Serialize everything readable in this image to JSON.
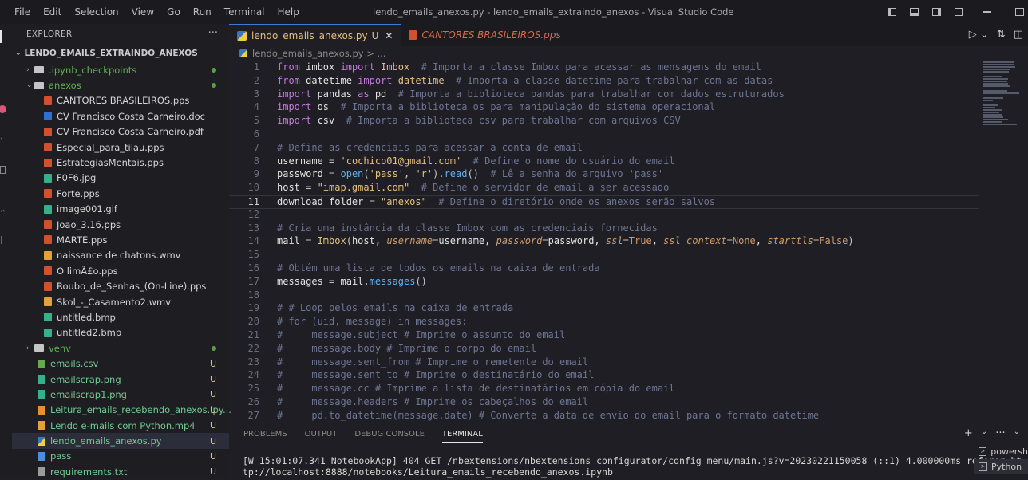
{
  "menubar": [
    "File",
    "Edit",
    "Selection",
    "View",
    "Go",
    "Run",
    "Terminal",
    "Help"
  ],
  "window_title": "lendo_emails_anexos.py - lendo_emails_extraindo_anexos - Visual Studio Code",
  "sidebar": {
    "title": "EXPLORER",
    "more": "···",
    "root": "LENDO_EMAILS_EXTRAINDO_ANEXOS",
    "items": [
      {
        "label": ".ipynb_checkpoints",
        "type": "folder",
        "indent": 1,
        "chevron": "›",
        "status": "dot",
        "color": "#61b04f"
      },
      {
        "label": "anexos",
        "type": "folder-open",
        "indent": 1,
        "chevron": "⌄",
        "status": "dot",
        "color": "#61b04f"
      },
      {
        "label": "CANTORES BRASILEIROS.pps",
        "type": "pps",
        "indent": 2,
        "color": "#d6d6d6"
      },
      {
        "label": "CV Francisco Costa Carneiro.doc",
        "type": "doc",
        "indent": 2,
        "color": "#d6d6d6"
      },
      {
        "label": "CV Francisco Costa Carneiro.pdf",
        "type": "pdf",
        "indent": 2,
        "color": "#d6d6d6"
      },
      {
        "label": "Especial_para_tilau.pps",
        "type": "pps",
        "indent": 2,
        "color": "#d6d6d6"
      },
      {
        "label": "EstrategiasMentais.pps",
        "type": "pps",
        "indent": 2,
        "color": "#d6d6d6"
      },
      {
        "label": "F0F6.jpg",
        "type": "img",
        "indent": 2,
        "color": "#d6d6d6"
      },
      {
        "label": "Forte.pps",
        "type": "pps",
        "indent": 2,
        "color": "#d6d6d6"
      },
      {
        "label": "image001.gif",
        "type": "img",
        "indent": 2,
        "color": "#d6d6d6"
      },
      {
        "label": "Joao_3.16.pps",
        "type": "pps",
        "indent": 2,
        "color": "#d6d6d6"
      },
      {
        "label": "MARTE.pps",
        "type": "pps",
        "indent": 2,
        "color": "#d6d6d6"
      },
      {
        "label": "naissance de chatons.wmv",
        "type": "video",
        "indent": 2,
        "color": "#d6d6d6"
      },
      {
        "label": "O limÃ£o.pps",
        "type": "pps",
        "indent": 2,
        "color": "#d6d6d6"
      },
      {
        "label": "Roubo_de_Senhas_(On-Line).pps",
        "type": "pps",
        "indent": 2,
        "color": "#d6d6d6"
      },
      {
        "label": "Skol_-_Casamento2.wmv",
        "type": "video",
        "indent": 2,
        "color": "#d6d6d6"
      },
      {
        "label": "untitled.bmp",
        "type": "img",
        "indent": 2,
        "color": "#d6d6d6"
      },
      {
        "label": "untitled2.bmp",
        "type": "img",
        "indent": 2,
        "color": "#d6d6d6"
      },
      {
        "label": "venv",
        "type": "folder",
        "indent": 1,
        "chevron": "›",
        "status": "dot",
        "color": "#61b04f"
      },
      {
        "label": "emails.csv",
        "type": "csv",
        "indent": 1,
        "status": "U",
        "color": "#73c991"
      },
      {
        "label": "emailscrap.png",
        "type": "img",
        "indent": 1,
        "status": "U",
        "color": "#73c991"
      },
      {
        "label": "emailscrap1.png",
        "type": "img",
        "indent": 1,
        "status": "U",
        "color": "#73c991"
      },
      {
        "label": "Leitura_emails_recebendo_anexos.ipy...",
        "type": "nb",
        "indent": 1,
        "status": "U",
        "color": "#73c991"
      },
      {
        "label": "Lendo e-mails com Python.mp4",
        "type": "video",
        "indent": 1,
        "status": "U",
        "color": "#73c991"
      },
      {
        "label": "lendo_emails_anexos.py",
        "type": "py",
        "indent": 1,
        "status": "U",
        "color": "#73c991",
        "selected": true
      },
      {
        "label": "pass",
        "type": "file",
        "indent": 1,
        "status": "U",
        "color": "#73c991"
      },
      {
        "label": "requirements.txt",
        "type": "txt",
        "indent": 1,
        "status": "U",
        "color": "#73c991"
      }
    ]
  },
  "tabs": [
    {
      "label": "lendo_emails_anexos.py",
      "badge": "U",
      "close": "✕",
      "active": true
    },
    {
      "label": "CANTORES BRASILEIROS.pps",
      "active": false
    }
  ],
  "breadcrumb": "lendo_emails_anexos.py > ...",
  "current_line": 11,
  "code": [
    [
      [
        "kw",
        "from"
      ],
      [
        "nm",
        " imbox "
      ],
      [
        "kw",
        "import"
      ],
      [
        "cls",
        " Imbox"
      ],
      [
        "cm",
        "  # Importa a classe Imbox para acessar as mensagens do email"
      ]
    ],
    [
      [
        "kw",
        "from"
      ],
      [
        "nm",
        " datetime "
      ],
      [
        "kw",
        "import"
      ],
      [
        "cls",
        " datetime"
      ],
      [
        "cm",
        "  # Importa a classe datetime para trabalhar com as datas"
      ]
    ],
    [
      [
        "kw",
        "import"
      ],
      [
        "nm",
        " pandas "
      ],
      [
        "kw",
        "as"
      ],
      [
        "nm",
        " pd"
      ],
      [
        "cm",
        "  # Importa a biblioteca pandas para trabalhar com dados estruturados"
      ]
    ],
    [
      [
        "kw",
        "import"
      ],
      [
        "nm",
        " os"
      ],
      [
        "cm",
        "  # Importa a biblioteca os para manipulação do sistema operacional"
      ]
    ],
    [
      [
        "kw",
        "import"
      ],
      [
        "nm",
        " csv"
      ],
      [
        "cm",
        "  # Importa a biblioteca csv para trabalhar com arquivos CSV"
      ]
    ],
    [],
    [
      [
        "cm",
        "# Define as credenciais para acessar a conta de email"
      ]
    ],
    [
      [
        "nm",
        "username "
      ],
      [
        "op",
        "="
      ],
      [
        "str",
        " 'cochico01@gmail.com'"
      ],
      [
        "cm",
        "  # Define o nome do usuário do email"
      ]
    ],
    [
      [
        "nm",
        "password "
      ],
      [
        "op",
        "="
      ],
      [
        "fn",
        " open"
      ],
      [
        "op",
        "("
      ],
      [
        "str",
        "'pass'"
      ],
      [
        "op",
        ", "
      ],
      [
        "str",
        "'r'"
      ],
      [
        "op",
        ")."
      ],
      [
        "fn",
        "read"
      ],
      [
        "op",
        "()"
      ],
      [
        "cm",
        "  # Lê a senha do arquivo 'pass'"
      ]
    ],
    [
      [
        "nm",
        "host "
      ],
      [
        "op",
        "="
      ],
      [
        "str",
        " \"imap.gmail.com\""
      ],
      [
        "cm",
        "  # Define o servidor de email a ser acessado"
      ]
    ],
    [
      [
        "nm",
        "download_folder "
      ],
      [
        "op",
        "="
      ],
      [
        "str",
        " \"anexos\""
      ],
      [
        "cm",
        "  # Define o diretório onde os anexos serão salvos"
      ]
    ],
    [],
    [
      [
        "cm",
        "# Cria uma instância da classe Imbox com as credenciais fornecidas"
      ]
    ],
    [
      [
        "nm",
        "mail "
      ],
      [
        "op",
        "="
      ],
      [
        "cls",
        " Imbox"
      ],
      [
        "op",
        "("
      ],
      [
        "nm",
        "host, "
      ],
      [
        "prm",
        "username"
      ],
      [
        "op",
        "="
      ],
      [
        "nm",
        "username, "
      ],
      [
        "prm",
        "password"
      ],
      [
        "op",
        "="
      ],
      [
        "nm",
        "password, "
      ],
      [
        "prm",
        "ssl"
      ],
      [
        "op",
        "="
      ],
      [
        "cst",
        "True"
      ],
      [
        "nm",
        ", "
      ],
      [
        "prm",
        "ssl_context"
      ],
      [
        "op",
        "="
      ],
      [
        "cst",
        "None"
      ],
      [
        "nm",
        ", "
      ],
      [
        "prm",
        "starttls"
      ],
      [
        "op",
        "="
      ],
      [
        "cst",
        "False"
      ],
      [
        "op",
        ")"
      ]
    ],
    [],
    [
      [
        "cm",
        "# Obtém uma lista de todos os emails na caixa de entrada"
      ]
    ],
    [
      [
        "nm",
        "messages "
      ],
      [
        "op",
        "="
      ],
      [
        "nm",
        " mail."
      ],
      [
        "fn",
        "messages"
      ],
      [
        "op",
        "()"
      ]
    ],
    [],
    [
      [
        "cm",
        "# # Loop pelos emails na caixa de entrada"
      ]
    ],
    [
      [
        "cm",
        "# for (uid, message) in messages:"
      ]
    ],
    [
      [
        "cm",
        "#     message.subject # Imprime o assunto do email"
      ]
    ],
    [
      [
        "cm",
        "#     message.body # Imprime o corpo do email"
      ]
    ],
    [
      [
        "cm",
        "#     message.sent_from # Imprime o remetente do email"
      ]
    ],
    [
      [
        "cm",
        "#     message.sent_to # Imprime o destinatário do email"
      ]
    ],
    [
      [
        "cm",
        "#     message.cc # Imprime a lista de destinatários em cópia do email"
      ]
    ],
    [
      [
        "cm",
        "#     message.headers # Imprime os cabeçalhos do email"
      ]
    ],
    [
      [
        "cm",
        "#     pd.to_datetime(message.date) # Converte a data de envio do email para o formato datetime"
      ]
    ]
  ],
  "panel": {
    "tabs": [
      "PROBLEMS",
      "OUTPUT",
      "DEBUG CONSOLE",
      "TERMINAL"
    ],
    "active_tab": "TERMINAL",
    "terminal_lines": [
      "[W 15:01:07.341 NotebookApp] 404 GET /nbextensions/nbextensions_configurator/config_menu/main.js?v=20230221150058 (::1) 4.000000ms referer=ht",
      "tp://localhost:8888/notebooks/Leitura_emails_recebendo_anexos.ipynb"
    ],
    "actions": [
      "+",
      "⌄",
      "···",
      "⌄"
    ],
    "terminals": [
      "powersh",
      "Python"
    ]
  },
  "colors": {
    "accent": "#3d7ad6",
    "untracked": "#73c991",
    "folder_dot": "#61b04f",
    "pps": "#d2502e",
    "doc": "#2f6fd1",
    "img": "#35b08a",
    "video": "#e1a23b"
  }
}
